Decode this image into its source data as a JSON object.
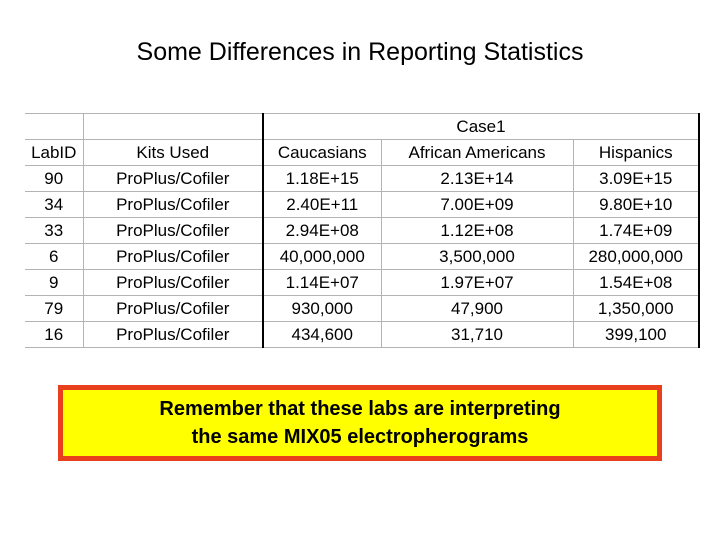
{
  "slide": {
    "title": "Some Differences in Reporting Statistics"
  },
  "table": {
    "band_header": {
      "spacer_label": "",
      "case_label": "Case1"
    },
    "columns": [
      "LabID",
      "Kits Used",
      "Caucasians",
      "African Americans",
      "Hispanics"
    ],
    "rows": [
      {
        "lab_id": "90",
        "kits_used": "ProPlus/Cofiler",
        "caucasians": "1.18E+15",
        "african_americans": "2.13E+14",
        "hispanics": "3.09E+15"
      },
      {
        "lab_id": "34",
        "kits_used": "ProPlus/Cofiler",
        "caucasians": "2.40E+11",
        "african_americans": "7.00E+09",
        "hispanics": "9.80E+10"
      },
      {
        "lab_id": "33",
        "kits_used": "ProPlus/Cofiler",
        "caucasians": "2.94E+08",
        "african_americans": "1.12E+08",
        "hispanics": "1.74E+09"
      },
      {
        "lab_id": "6",
        "kits_used": "ProPlus/Cofiler",
        "caucasians": "40,000,000",
        "african_americans": "3,500,000",
        "hispanics": "280,000,000"
      },
      {
        "lab_id": "9",
        "kits_used": "ProPlus/Cofiler",
        "caucasians": "1.14E+07",
        "african_americans": "1.97E+07",
        "hispanics": "1.54E+08"
      },
      {
        "lab_id": "79",
        "kits_used": "ProPlus/Cofiler",
        "caucasians": "930,000",
        "african_americans": "47,900",
        "hispanics": "1,350,000"
      },
      {
        "lab_id": "16",
        "kits_used": "ProPlus/Cofiler",
        "caucasians": "434,600",
        "african_americans": "31,710",
        "hispanics": "399,100"
      }
    ]
  },
  "callout": {
    "line1": "Remember that these labs are interpreting",
    "line2": "the same MIX05 electropherograms",
    "background_color": "#ffff00",
    "border_color": "#e8401c",
    "text_color": "#000000"
  }
}
